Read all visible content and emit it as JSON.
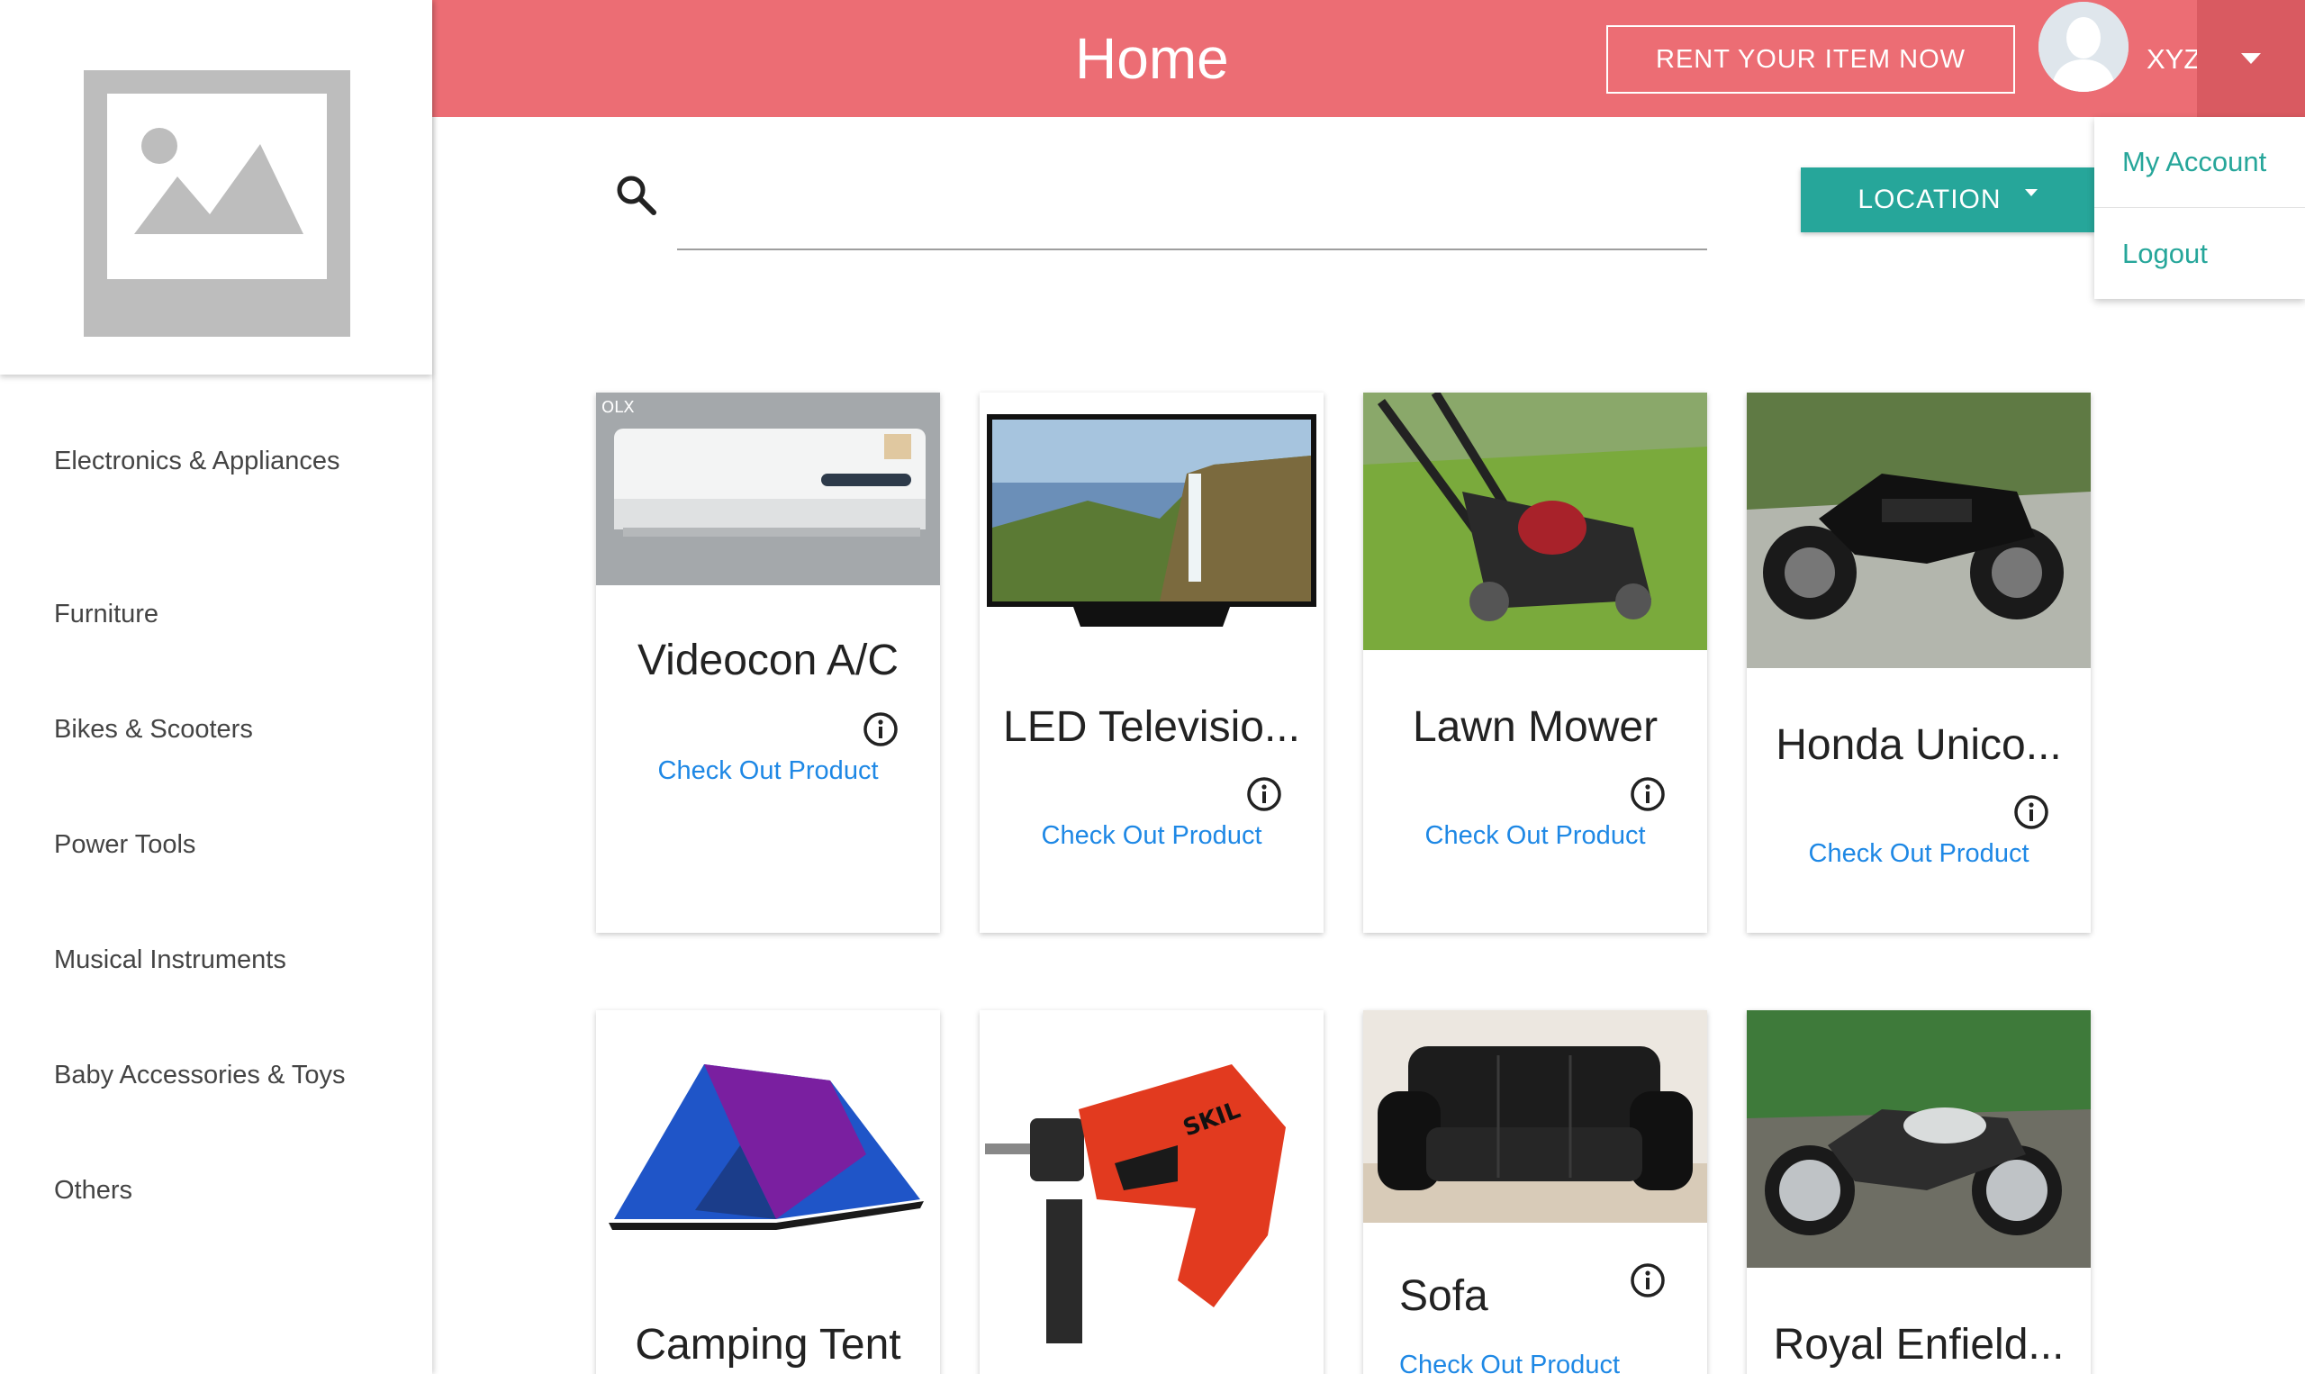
{
  "header": {
    "title": "Home",
    "rent_button": "RENT YOUR ITEM NOW",
    "username": "XYZ",
    "colors": {
      "header": "#ec6d74",
      "accent": "#26a69a",
      "link": "#1e88e5"
    }
  },
  "account_menu": {
    "items": [
      {
        "label": "My Account"
      },
      {
        "label": "Logout"
      }
    ]
  },
  "search": {
    "placeholder": "",
    "location_button": "LOCATION"
  },
  "sidebar": {
    "logo_icon": "image-placeholder-icon",
    "categories": [
      {
        "label": "Electronics & Appliances"
      },
      {
        "label": "Furniture"
      },
      {
        "label": "Bikes & Scooters"
      },
      {
        "label": "Power Tools"
      },
      {
        "label": "Musical Instruments"
      },
      {
        "label": "Baby Accessories & Toys"
      },
      {
        "label": "Others"
      }
    ]
  },
  "products": [
    {
      "title": "Videocon A/C",
      "link": "Check Out Product",
      "image": "air-conditioner-photo"
    },
    {
      "title": "LED Televisio...",
      "link": "Check Out Product",
      "image": "led-tv-photo"
    },
    {
      "title": "Lawn Mower",
      "link": "Check Out Product",
      "image": "lawn-mower-photo"
    },
    {
      "title": "Honda Unico...",
      "link": "Check Out Product",
      "image": "motorcycle-photo"
    },
    {
      "title": "Camping Tent",
      "link": "",
      "image": "tent-photo"
    },
    {
      "title": "",
      "link": "",
      "image": "drill-photo"
    },
    {
      "title": "Sofa",
      "link": "Check Out Product",
      "image": "sofa-photo"
    },
    {
      "title": "Royal Enfield...",
      "link": "",
      "image": "royal-enfield-photo"
    }
  ]
}
